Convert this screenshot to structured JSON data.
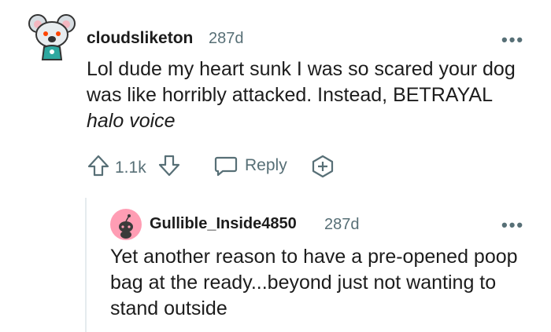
{
  "comments": [
    {
      "username": "cloudsliketon",
      "age": "287d",
      "text_main": "Lol dude my heart sunk I was so scared your dog was like horribly attacked. Instead, BETRAYAL ",
      "text_italic": "halo voice",
      "upvotes": "1.1k",
      "reply_label": "Reply",
      "more_label": "•••"
    },
    {
      "username": "Gullible_Inside4850",
      "age": "287d",
      "text": "Yet another reason to have a pre-opened poop bag at the ready...beyond just not wanting to stand outside",
      "more_label": "•••"
    }
  ],
  "colors": {
    "meta_gray": "#576f76",
    "avatar2_bg": "#ff9db4",
    "avatar1_accent": "#2ea8a0"
  },
  "icons": [
    "snoo-koala-avatar-icon",
    "upvote-arrow-icon",
    "downvote-arrow-icon",
    "reply-bubble-icon",
    "award-plus-icon",
    "snoo-default-avatar-icon",
    "more-dots-icon"
  ]
}
